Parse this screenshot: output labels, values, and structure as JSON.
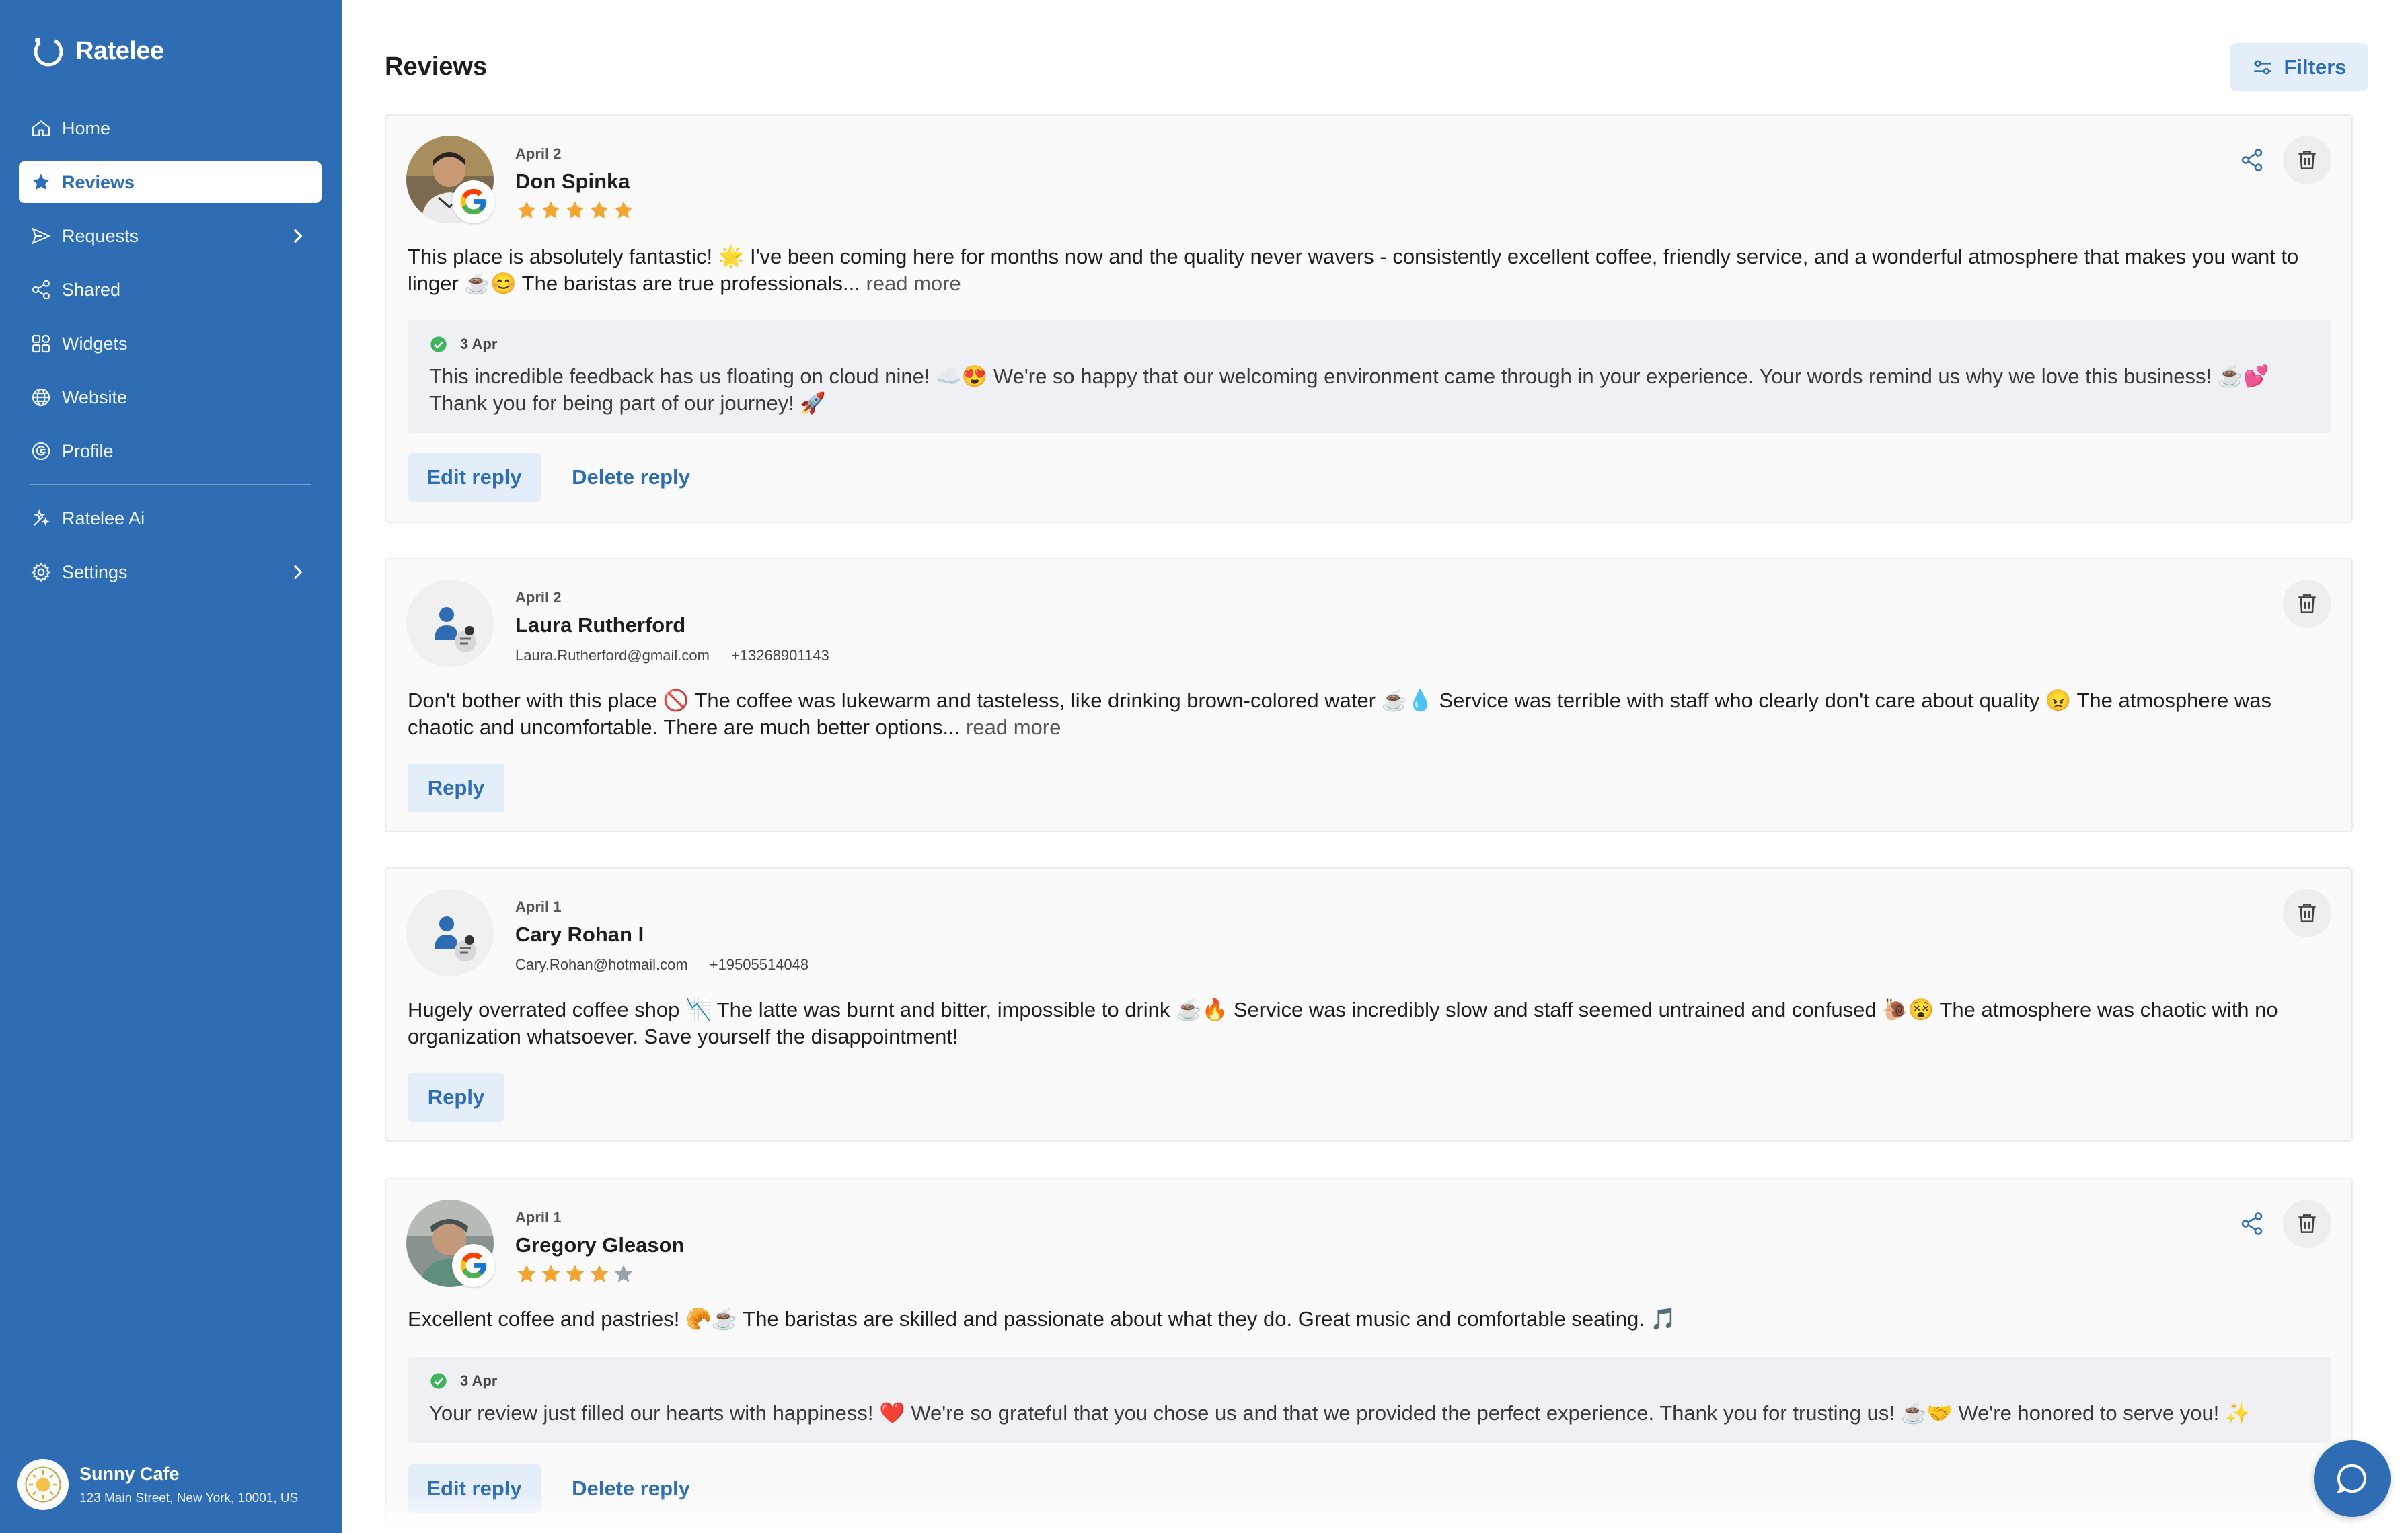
{
  "app": {
    "name": "Ratelee"
  },
  "nav": {
    "items": [
      {
        "label": "Home",
        "icon": "home-icon"
      },
      {
        "label": "Reviews",
        "icon": "star-icon",
        "active": true
      },
      {
        "label": "Requests",
        "icon": "send-icon",
        "has_submenu": true
      },
      {
        "label": "Shared",
        "icon": "share-icon"
      },
      {
        "label": "Widgets",
        "icon": "widgets-icon"
      },
      {
        "label": "Website",
        "icon": "globe-icon"
      },
      {
        "label": "Profile",
        "icon": "google-icon"
      },
      {
        "label": "Ratelee Ai",
        "icon": "ai-sparkle-icon"
      },
      {
        "label": "Settings",
        "icon": "gear-icon",
        "has_submenu": true
      }
    ]
  },
  "business": {
    "name": "Sunny Cafe",
    "address": "123 Main Street, New York, 10001, US"
  },
  "page": {
    "title": "Reviews",
    "filters_label": "Filters"
  },
  "colors": {
    "primary": "#2e6db4",
    "star": "#f2a533",
    "star_empty": "#9aa3ad",
    "check": "#3cb55e"
  },
  "reviews": [
    {
      "date": "April 2",
      "name": "Don Spinka",
      "source": "google",
      "rating": 5,
      "text": "This place is absolutely fantastic! 🌟 I've been coming here for months now and the quality never wavers - consistently excellent coffee, friendly service, and a wonderful atmosphere that makes you want to linger ☕😊 The baristas are true professionals...",
      "read_more": "read more",
      "reply": {
        "date": "3 Apr",
        "text": "This incredible feedback has us floating on cloud nine! ☁️😍 We're so happy that our welcoming environment came through in your experience. Your words remind us why we love this business! ☕💕 Thank you for being part of our journey! 🚀"
      },
      "buttons": [
        "Edit reply",
        "Delete reply"
      ]
    },
    {
      "date": "April 2",
      "name": "Laura Rutherford",
      "email": "Laura.Rutherford@gmail.com",
      "phone": "+13268901143",
      "text": "Don't bother with this place 🚫 The coffee was lukewarm and tasteless, like drinking brown-colored water ☕💧 Service was terrible with staff who clearly don't care about quality 😠 The atmosphere was chaotic and uncomfortable. There are much better options...",
      "read_more": "read more",
      "buttons": [
        "Reply"
      ]
    },
    {
      "date": "April 1",
      "name": "Cary Rohan I",
      "email": "Cary.Rohan@hotmail.com",
      "phone": "+19505514048",
      "text": "Hugely overrated coffee shop 📉 The latte was burnt and bitter, impossible to drink ☕🔥 Service was incredibly slow and staff seemed untrained and confused 🐌😵 The atmosphere was chaotic with no organization whatsoever. Save yourself the disappointment!",
      "buttons": [
        "Reply"
      ]
    },
    {
      "date": "April 1",
      "name": "Gregory Gleason",
      "source": "google",
      "rating": 4,
      "text": "Excellent coffee and pastries! 🥐☕ The baristas are skilled and passionate about what they do. Great music and comfortable seating. 🎵",
      "reply": {
        "date": "3 Apr",
        "text": "Your review just filled our hearts with happiness! ❤️ We're so grateful that you chose us and that we provided the perfect experience. Thank you for trusting us! ☕🤝 We're honored to serve you! ✨"
      },
      "buttons": [
        "Edit reply",
        "Delete reply"
      ]
    }
  ]
}
